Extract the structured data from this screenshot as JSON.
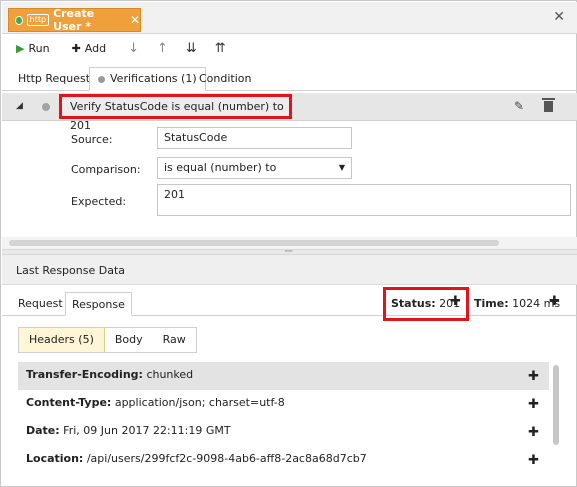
{
  "tab": {
    "title": "Create User *",
    "badge": "http",
    "close": "✕"
  },
  "window": {
    "close": "✕"
  },
  "toolbar": {
    "run_label": "Run",
    "add_label": "Add"
  },
  "subtabs": [
    "Http Request",
    "Verifications (1)",
    "Condition"
  ],
  "verification": {
    "label": "Verify StatusCode is equal (number) to 201",
    "source_label": "Source:",
    "source_value": "StatusCode",
    "comparison_label": "Comparison:",
    "comparison_value": "is equal (number) to",
    "expected_label": "Expected:",
    "expected_value": "201"
  },
  "last_response": {
    "title": "Last Response Data",
    "tabs": [
      "Request",
      "Response"
    ],
    "status_label": "Status:",
    "status_value": "201",
    "time_label": "Time:",
    "time_value": "1024 ms",
    "segments": [
      "Headers (5)",
      "Body",
      "Raw"
    ],
    "headers": [
      {
        "key": "Transfer-Encoding:",
        "value": "chunked"
      },
      {
        "key": "Content-Type:",
        "value": "application/json; charset=utf-8"
      },
      {
        "key": "Date:",
        "value": "Fri, 09 Jun 2017 22:11:19 GMT"
      },
      {
        "key": "Location:",
        "value": "/api/users/299fcf2c-9098-4ab6-aff8-2ac8a68d7cb7"
      }
    ]
  },
  "colors": {
    "tab_accent": "#f0a03a",
    "highlight": "#e0141a",
    "active_segment": "#fff6d6"
  }
}
